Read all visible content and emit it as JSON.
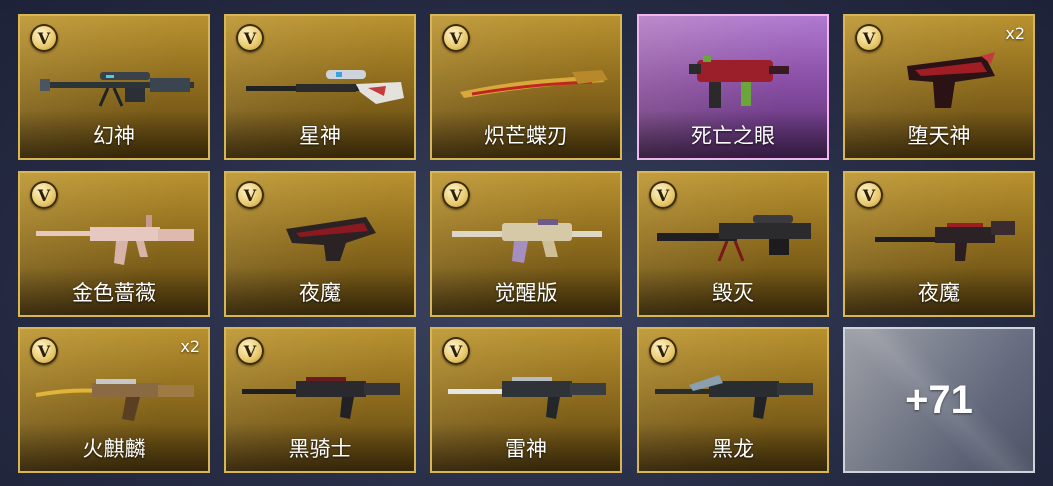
{
  "badge_letter": "V",
  "colors": {
    "gold": "#d9b654",
    "purple": "#efb6ef",
    "gray": "#cfd3dc"
  },
  "items": [
    {
      "name": "幻神",
      "count": "",
      "icon": "sniper-rifle-icon"
    },
    {
      "name": "星神",
      "count": "",
      "icon": "bolt-rifle-icon"
    },
    {
      "name": "炽芒蝶刃",
      "count": "",
      "icon": "butterfly-blade-icon"
    },
    {
      "name": "死亡之眼",
      "count": "",
      "icon": "smg-icon"
    },
    {
      "name": "堕天神",
      "count": "x2",
      "icon": "dragon-pistol-icon"
    },
    {
      "name": "金色蔷薇",
      "count": "",
      "icon": "assault-rifle-icon"
    },
    {
      "name": "夜魔",
      "count": "",
      "icon": "blaster-icon"
    },
    {
      "name": "觉醒版",
      "count": "",
      "icon": "rifle-icon"
    },
    {
      "name": "毁灭",
      "count": "",
      "icon": "heavy-sniper-icon"
    },
    {
      "name": "夜魔",
      "count": "",
      "icon": "carbine-icon"
    },
    {
      "name": "火麒麟",
      "count": "x2",
      "icon": "ak-rifle-icon"
    },
    {
      "name": "黑骑士",
      "count": "",
      "icon": "m4-rifle-icon"
    },
    {
      "name": "雷神",
      "count": "",
      "icon": "m4-rifle-icon"
    },
    {
      "name": "黑龙",
      "count": "",
      "icon": "m4-rifle-icon"
    }
  ],
  "more": {
    "label": "+71"
  }
}
